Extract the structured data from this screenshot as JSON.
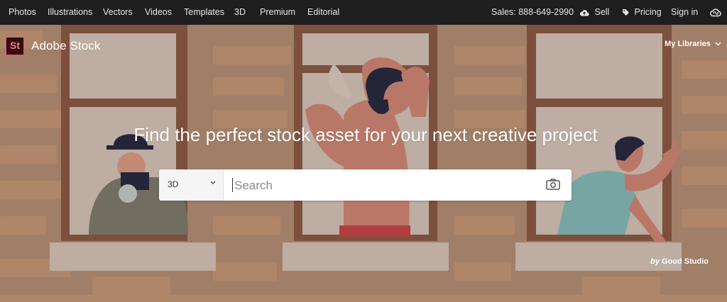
{
  "nav": {
    "items": [
      "Photos",
      "Illustrations",
      "Vectors",
      "Videos",
      "Templates",
      "3D",
      "Premium",
      "Editorial"
    ],
    "sales": "Sales: 888-649-2990",
    "sell": "Sell",
    "pricing": "Pricing",
    "signin": "Sign in"
  },
  "brand": {
    "badge": "St",
    "name": "Adobe Stock"
  },
  "my_libraries": "My Libraries",
  "headline": "Find the perfect stock asset for your next creative project",
  "search": {
    "category": "3D",
    "placeholder": "Search"
  },
  "credit": {
    "by": "by",
    "author": "Good Studio"
  },
  "colors": {
    "nav_bg": "#1e1e1e",
    "brand_accent": "#ff4c6a",
    "brick": "#c89b7b"
  }
}
